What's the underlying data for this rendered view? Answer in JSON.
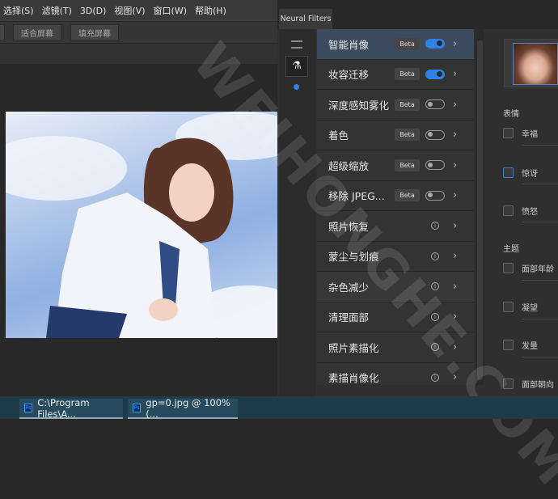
{
  "menu": [
    "选择(S)",
    "滤镜(T)",
    "3D(D)",
    "视图(V)",
    "窗口(W)",
    "帮助(H)"
  ],
  "toolbar": {
    "fit_screen": "适合屏幕",
    "fill_screen": "填充屏幕"
  },
  "panel": {
    "tab": "Neural Filters",
    "filters": [
      {
        "label": "智能肖像",
        "badge": "Beta",
        "toggle": "on"
      },
      {
        "label": "妆容迁移",
        "badge": "Beta",
        "toggle": "on"
      },
      {
        "label": "深度感知雾化",
        "badge": "Beta",
        "toggle": "off"
      },
      {
        "label": "着色",
        "badge": "Beta",
        "toggle": "off"
      },
      {
        "label": "超级缩放",
        "badge": "Beta",
        "toggle": "off"
      },
      {
        "label": "移除 JPEG...",
        "badge": "Beta",
        "toggle": "off"
      },
      {
        "label": "照片恢复",
        "info": "i"
      },
      {
        "label": "蒙尘与划痕",
        "info": "i"
      },
      {
        "label": "杂色减少",
        "info": "i"
      },
      {
        "label": "清理面部",
        "info": "i"
      },
      {
        "label": "照片素描化",
        "info": "i"
      },
      {
        "label": "素描肖像化",
        "info": "i"
      }
    ],
    "settings": {
      "section_expression": "表情",
      "happiness": "幸福",
      "surprise": "惊讶",
      "anger": "愤怒",
      "section_theme": "主题",
      "facial_age": "面部年龄",
      "gaze": "凝望",
      "hair_thickness": "发量",
      "head_direction": "面部朝向"
    }
  },
  "taskbar": [
    {
      "label": "C:\\Program Files\\A..."
    },
    {
      "label": "gp=0.jpg @ 100% (..."
    }
  ],
  "watermark": "WEIHONGHE.COM",
  "colors": {
    "accent": "#2f82e6",
    "selected_row": "#3d4b5e"
  }
}
